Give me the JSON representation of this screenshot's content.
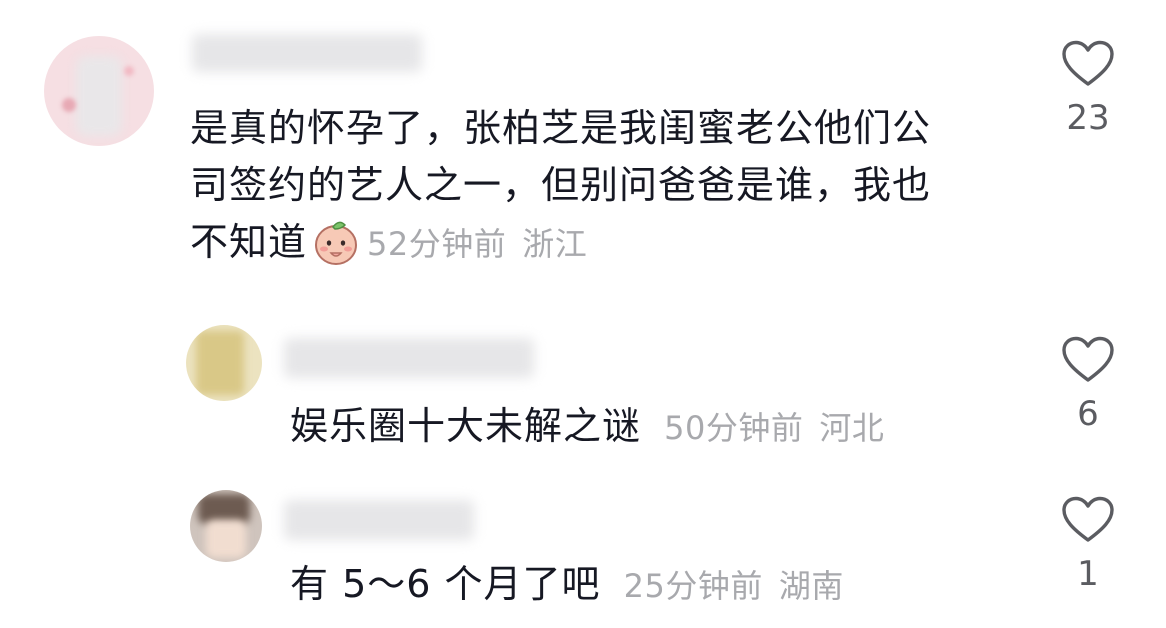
{
  "comments": [
    {
      "text_lines": [
        "是真的怀孕了，张柏芝是我闺蜜老公他们公",
        "司签约的艺人之一，但别问爸爸是谁，我也",
        "不知道"
      ],
      "emoji": "embarrassed-peach-emoji",
      "time": "52分钟前",
      "location": "浙江",
      "likes": "23"
    },
    {
      "text": "娱乐圈十大未解之谜",
      "time": "50分钟前",
      "location": "河北",
      "likes": "6"
    },
    {
      "text": "有 5～6 个月了吧",
      "time": "25分钟前",
      "location": "湖南",
      "likes": "1"
    }
  ],
  "icons": {
    "like": "heart-outline-icon"
  },
  "colors": {
    "text": "#161823",
    "meta": "#a8a9ad",
    "count": "#5b5c61",
    "background": "#ffffff"
  }
}
